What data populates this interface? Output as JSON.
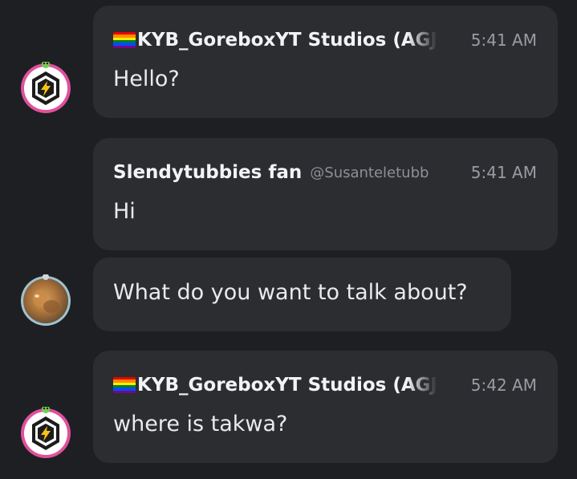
{
  "messages": [
    {
      "author": "KYB_GoreboxYT Studios (AGJ",
      "time": "5:41 AM",
      "text": "Hello?",
      "has_flag": true,
      "avatar": "bolt-shield-avatar"
    },
    {
      "author": "Slendytubbies fan",
      "handle": "@Susanteletubb",
      "time": "5:41 AM",
      "text": "Hi"
    },
    {
      "text": "What do you want to talk about?",
      "avatar": "blurry-character-avatar"
    },
    {
      "author": "KYB_GoreboxYT Studios (AGJ",
      "time": "5:42 AM",
      "text": "where is takwa?",
      "has_flag": true,
      "avatar": "bolt-shield-avatar"
    }
  ],
  "colors": {
    "background": "#1e1f22",
    "bubble": "#2b2d31",
    "text": "#e9eaec",
    "muted": "#9a9ca3"
  }
}
